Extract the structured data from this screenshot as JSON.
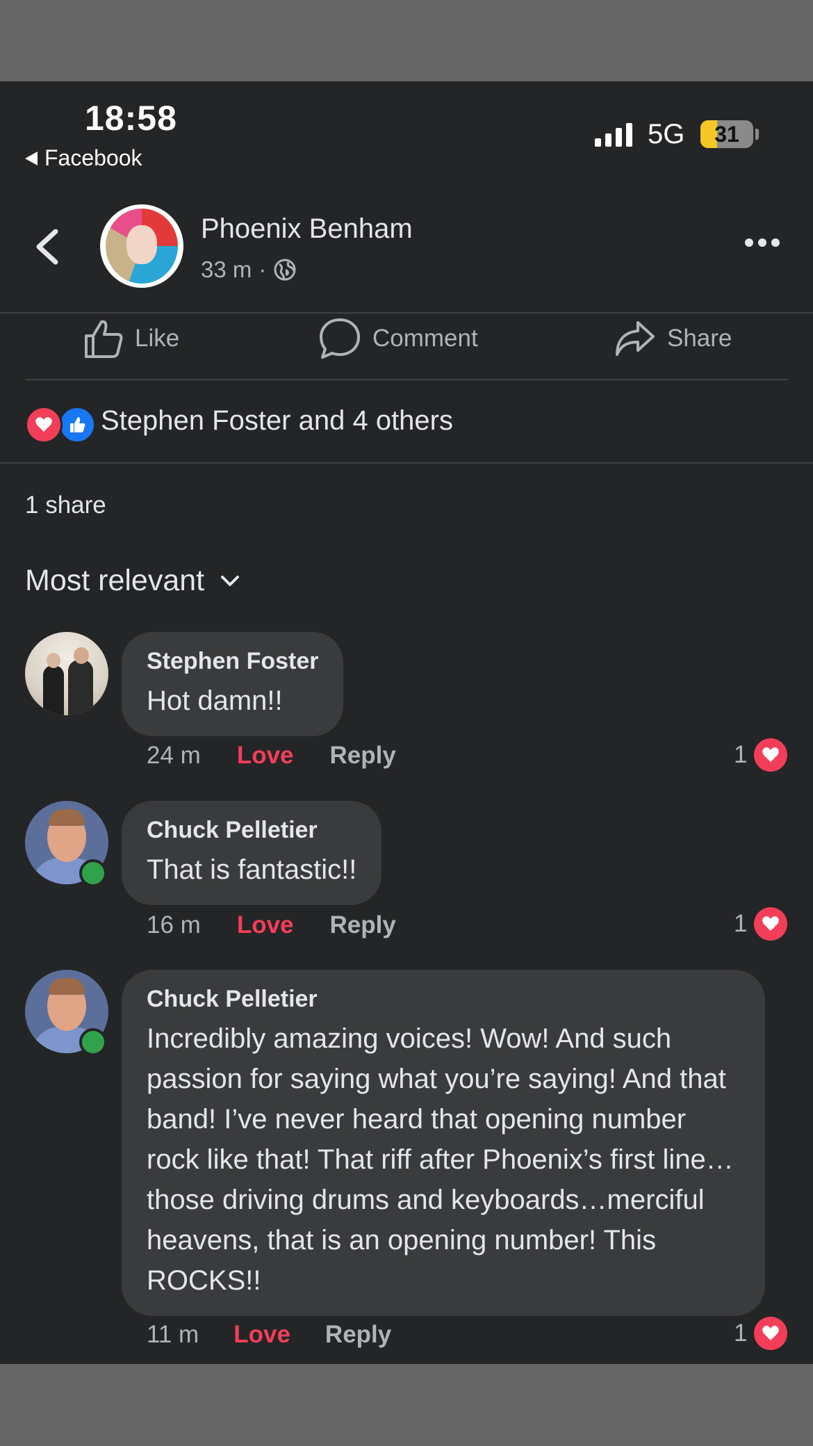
{
  "status_bar": {
    "time": "18:58",
    "back_app": "Facebook",
    "network": "5G",
    "battery": "31",
    "battery_level": 0.31
  },
  "header": {
    "page_name": "Phoenix Benham",
    "time_ago": "33 m",
    "separator": "·",
    "audience_icon": "globe-icon"
  },
  "actions": {
    "like": "Like",
    "comment": "Comment",
    "share": "Share"
  },
  "reactions": {
    "summary": "Stephen Foster and 4 others",
    "types": [
      "love",
      "like"
    ]
  },
  "shares": "1 share",
  "sort": {
    "label": "Most relevant"
  },
  "comments": [
    {
      "author": "Stephen Foster",
      "text": "Hot damn!!",
      "time": "24 m",
      "love": "Love",
      "reply": "Reply",
      "reaction_count": "1",
      "online": false
    },
    {
      "author": "Chuck Pelletier",
      "text": "That is fantastic!!",
      "time": "16 m",
      "love": "Love",
      "reply": "Reply",
      "reaction_count": "1",
      "online": true
    },
    {
      "author": "Chuck Pelletier",
      "text": "Incredibly amazing voices! Wow!  And such passion for saying what you’re saying!  And that band!  I’ve never heard that opening number rock like that!  That riff after Phoenix’s first line…those driving drums and keyboards…merciful heavens, that is an opening number! This  ROCKS!!",
      "time": "11 m",
      "love": "Love",
      "reply": "Reply",
      "reaction_count": "1",
      "online": true
    }
  ],
  "colors": {
    "background": "#242526",
    "bubble": "#3a3b3c",
    "love": "#f33e58",
    "like": "#1877f2",
    "online": "#31a24c",
    "secondary_text": "#b0b3b8"
  }
}
